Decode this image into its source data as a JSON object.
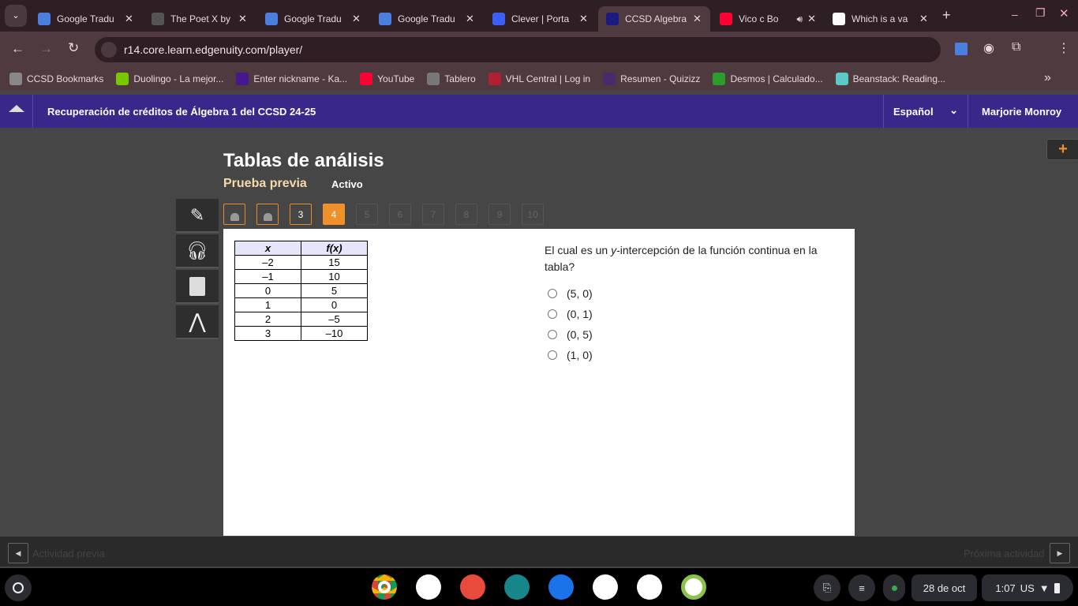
{
  "browser": {
    "tabs": [
      {
        "title": "Google Tradu",
        "favicon": "google-translate-icon",
        "color": "#4a7fe0"
      },
      {
        "title": "The Poet X by",
        "favicon": "loading-icon",
        "color": "#555"
      },
      {
        "title": "Google Tradu",
        "favicon": "google-translate-icon",
        "color": "#4a7fe0"
      },
      {
        "title": "Google Tradu",
        "favicon": "google-translate-icon",
        "color": "#4a7fe0"
      },
      {
        "title": "Clever | Porta",
        "favicon": "clever-icon",
        "color": "#3b5ff5"
      },
      {
        "title": "CCSD Algebra",
        "favicon": "edgenuity-icon",
        "color": "#1a1a80",
        "active": true
      },
      {
        "title": "Vico c Bo",
        "favicon": "youtube-icon",
        "color": "#f03",
        "audio": true
      },
      {
        "title": "Which is a va",
        "favicon": "google-icon",
        "color": "#fff"
      }
    ],
    "url": "r14.core.learn.edgenuity.com/player/",
    "bookmarks": [
      {
        "label": "CCSD Bookmarks",
        "color": "#888"
      },
      {
        "label": "Duolingo - La mejor...",
        "color": "#78c800"
      },
      {
        "label": "Enter nickname - Ka...",
        "color": "#46178f"
      },
      {
        "label": "YouTube",
        "color": "#f03"
      },
      {
        "label": "Tablero",
        "color": "#777"
      },
      {
        "label": "VHL Central | Log in",
        "color": "#b02030"
      },
      {
        "label": "Resumen - Quizizz",
        "color": "#4a2a6a"
      },
      {
        "label": "Desmos | Calculado...",
        "color": "#2c9c2c"
      },
      {
        "label": "Beanstack: Reading...",
        "color": "#5cc8c8"
      }
    ]
  },
  "header": {
    "course": "Recuperación de créditos de Álgebra 1 del CCSD 24-25",
    "language": "Español",
    "user": "Marjorie Monroy"
  },
  "activity": {
    "title": "Tablas de análisis",
    "subtitle": "Prueba previa",
    "status": "Activo"
  },
  "questions": [
    {
      "label": "",
      "state": "locked"
    },
    {
      "label": "",
      "state": "locked"
    },
    {
      "label": "3",
      "state": "available"
    },
    {
      "label": "4",
      "state": "current"
    },
    {
      "label": "5",
      "state": "disabled"
    },
    {
      "label": "6",
      "state": "disabled"
    },
    {
      "label": "7",
      "state": "disabled"
    },
    {
      "label": "8",
      "state": "disabled"
    },
    {
      "label": "9",
      "state": "disabled"
    },
    {
      "label": "10",
      "state": "disabled"
    }
  ],
  "table": {
    "headers": [
      "x",
      "f(x)"
    ],
    "rows": [
      [
        "–2",
        "15"
      ],
      [
        "–1",
        "10"
      ],
      [
        "0",
        "5"
      ],
      [
        "1",
        "0"
      ],
      [
        "2",
        "–5"
      ],
      [
        "3",
        "–10"
      ]
    ]
  },
  "question": {
    "pre": "El cual es un ",
    "var": "y",
    "post": "-intercepción de la función continua en la tabla?"
  },
  "options": [
    "(5, 0)",
    "(0, 1)",
    "(0, 5)",
    "(1, 0)"
  ],
  "footer": {
    "prev": "Actividad previa",
    "next": "Próxima actividad"
  },
  "shelf": {
    "date": "28 de oct",
    "time": "1:07",
    "locale": "US"
  },
  "accent": "#f0902a"
}
